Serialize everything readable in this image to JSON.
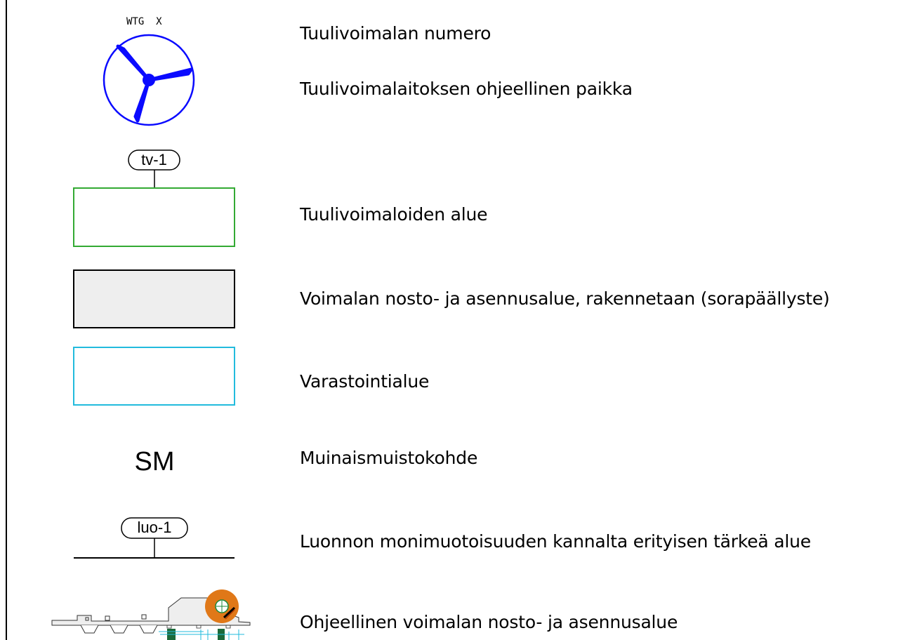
{
  "legend": {
    "items": [
      {
        "symbol": "wtg-number",
        "symbol_label": "WTG  X",
        "text": "Tuulivoimalan numero"
      },
      {
        "symbol": "turbine-icon",
        "text": "Tuulivoimalaitoksen ohjeellinen paikka"
      },
      {
        "symbol": "tv-area",
        "tag": "tv-1",
        "text": "Tuulivoimaloiden alue"
      },
      {
        "symbol": "gray-rect",
        "text": "Voimalan nosto- ja asennusalue, rakennetaan (sorapäällyste)"
      },
      {
        "symbol": "cyan-rect",
        "text": "Varastointialue"
      },
      {
        "symbol": "sm-text",
        "symbol_label": "SM",
        "text": "Muinaismuistokohde"
      },
      {
        "symbol": "luo-line",
        "tag": "luo-1",
        "text": "Luonnon monimuotoisuuden kannalta erityisen tärkeä alue"
      },
      {
        "symbol": "site-plan-thumbnail",
        "text": "Ohjeellinen voimalan nosto- ja asennusalue"
      }
    ]
  },
  "colors": {
    "turbine_blue": "#0a0aff",
    "area_green": "#33aa33",
    "gray_fill": "#eeeeee",
    "storage_cyan": "#22bbdd",
    "orange": "#e07818",
    "dark_green": "#1a6a3a"
  }
}
